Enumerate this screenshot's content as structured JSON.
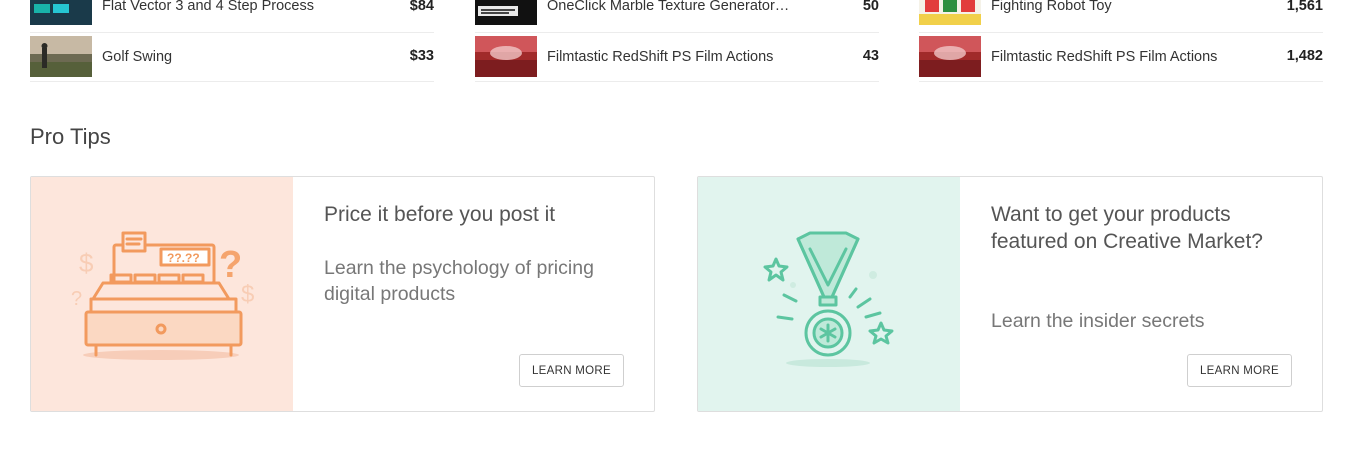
{
  "popular_lists": [
    {
      "items": [
        {
          "name": "Flat Vector 3 and 4 Step Process",
          "value": "$84",
          "thumb": "flat-vector-thumbnail"
        },
        {
          "name": "Golf Swing",
          "value": "$33",
          "thumb": "golf-swing-thumbnail"
        }
      ]
    },
    {
      "items": [
        {
          "name": "OneClick Marble Texture Generator…",
          "value": "50",
          "thumb": "marble-generator-thumbnail"
        },
        {
          "name": "Filmtastic RedShift PS Film Actions",
          "value": "43",
          "thumb": "redshift-thumbnail"
        }
      ]
    },
    {
      "items": [
        {
          "name": "Fighting Robot Toy",
          "value": "1,561",
          "thumb": "robot-toy-thumbnail"
        },
        {
          "name": "Filmtastic RedShift PS Film Actions",
          "value": "1,482",
          "thumb": "redshift-thumbnail"
        }
      ]
    }
  ],
  "pro_tips": {
    "title": "Pro Tips",
    "cards": [
      {
        "title": "Price it before you post it",
        "description": "Learn the psychology of pricing digital products",
        "button": "LEARN MORE",
        "illustration": "cash-register-icon",
        "illustration_bg": "#fde6dc",
        "accent": "#f29a5e"
      },
      {
        "title": "Want to get your products featured on Creative Market?",
        "description": "Learn the insider secrets",
        "button": "LEARN MORE",
        "illustration": "medal-icon",
        "illustration_bg": "#e1f4ee",
        "accent": "#5cc5a0"
      }
    ]
  }
}
